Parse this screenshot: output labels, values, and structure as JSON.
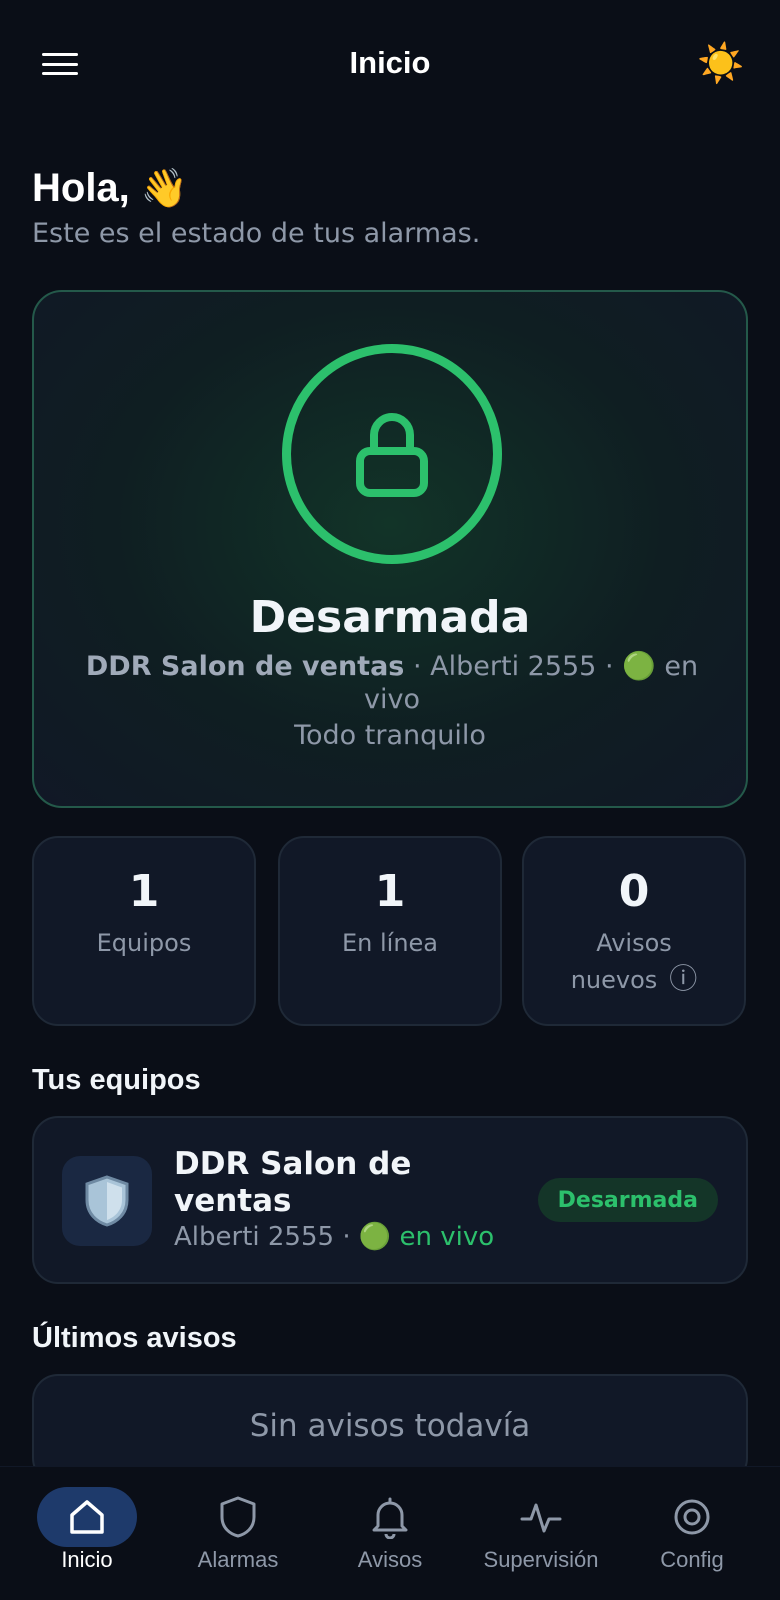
{
  "header": {
    "title": "Inicio",
    "theme_icon": "☀️"
  },
  "greeting": {
    "title": "Hola,",
    "wave": "👋",
    "subtitle": "Este es el estado de tus alarmas."
  },
  "status": {
    "state": "Desarmada",
    "device_name": "DDR Salon de ventas",
    "address": "Alberti 2555",
    "live_dot": "🟢",
    "live_label": "en vivo",
    "message": "Todo tranquilo",
    "accent_color": "#2cc06c"
  },
  "stats": [
    {
      "value": "1",
      "label": "Equipos"
    },
    {
      "value": "1",
      "label": "En línea"
    },
    {
      "value": "0",
      "label": "Avisos nuevos",
      "info_icon": "ⓘ"
    }
  ],
  "devices_section": {
    "title": "Tus equipos",
    "items": [
      {
        "icon": "🛡️",
        "name": "DDR Salon de ventas",
        "address": "Alberti 2555",
        "live_dot": "🟢",
        "live_label": "en vivo",
        "status_badge": "Desarmada"
      }
    ]
  },
  "alerts_section": {
    "title": "Últimos avisos",
    "empty_text": "Sin avisos todavía"
  },
  "bottom_nav": [
    {
      "label": "Inicio",
      "icon": "home-icon",
      "active": true
    },
    {
      "label": "Alarmas",
      "icon": "shield-icon",
      "active": false
    },
    {
      "label": "Avisos",
      "icon": "bell-icon",
      "active": false
    },
    {
      "label": "Supervisión",
      "icon": "activity-icon",
      "active": false
    },
    {
      "label": "Config",
      "icon": "target-icon",
      "active": false
    }
  ]
}
